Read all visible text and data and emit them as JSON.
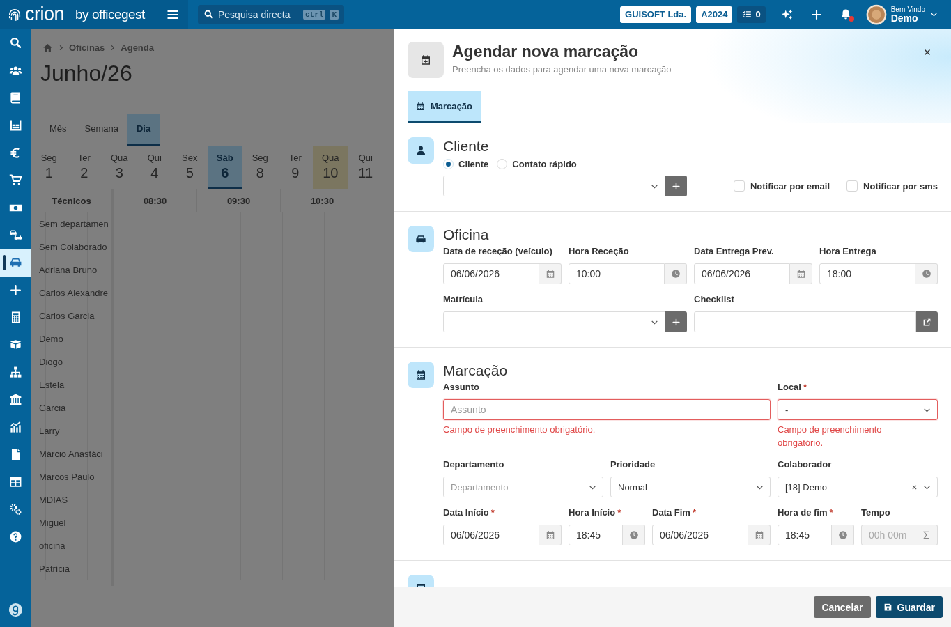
{
  "topbar": {
    "logo": "crion",
    "logo_suffix": "by officegest",
    "search": {
      "placeholder": "Pesquisa directa",
      "keys": [
        "ctrl",
        "K"
      ]
    },
    "company": "GUISOFT Lda.",
    "year": "A2024",
    "tasks": "0",
    "notifications": {
      "unread": true
    },
    "user": {
      "greeting": "Bem-Vindo",
      "name": "Demo"
    }
  },
  "sidebar": {
    "items": [
      {
        "kind": "search",
        "selected": false
      },
      {
        "kind": "users",
        "selected": false
      },
      {
        "kind": "book",
        "selected": false
      },
      {
        "kind": "shelves",
        "selected": false
      },
      {
        "kind": "euro",
        "selected": false
      },
      {
        "kind": "cart",
        "selected": false
      },
      {
        "kind": "money",
        "selected": false
      },
      {
        "kind": "cars",
        "selected": false
      },
      {
        "kind": "car",
        "selected": true
      },
      {
        "kind": "plus",
        "selected": false
      },
      {
        "kind": "calculator",
        "selected": false
      },
      {
        "kind": "box",
        "selected": false
      },
      {
        "kind": "sitemap",
        "selected": false
      },
      {
        "kind": "bank",
        "selected": false
      },
      {
        "kind": "chart",
        "selected": false
      },
      {
        "kind": "file",
        "selected": false
      },
      {
        "kind": "table",
        "selected": false
      },
      {
        "kind": "gears",
        "selected": false
      },
      {
        "kind": "help",
        "selected": false
      }
    ]
  },
  "breadcrumb": [
    "Oficinas",
    "Agenda"
  ],
  "page_title": "Junho/26",
  "view_tabs": [
    {
      "label": "Mês",
      "selected": false
    },
    {
      "label": "Semana",
      "selected": false
    },
    {
      "label": "Dia",
      "selected": true
    }
  ],
  "days": [
    {
      "weekday": "Seg",
      "day": "1",
      "selected": false,
      "today": false
    },
    {
      "weekday": "Ter",
      "day": "2",
      "selected": false,
      "today": false
    },
    {
      "weekday": "Qua",
      "day": "3",
      "selected": false,
      "today": false
    },
    {
      "weekday": "Qui",
      "day": "4",
      "selected": false,
      "today": false
    },
    {
      "weekday": "Sex",
      "day": "5",
      "selected": false,
      "today": false
    },
    {
      "weekday": "Sáb",
      "day": "6",
      "selected": true,
      "today": false
    },
    {
      "weekday": "Seg",
      "day": "8",
      "selected": false,
      "today": false
    },
    {
      "weekday": "Ter",
      "day": "9",
      "selected": false,
      "today": false
    },
    {
      "weekday": "Qua",
      "day": "10",
      "selected": false,
      "today": true
    },
    {
      "weekday": "Qui",
      "day": "11",
      "selected": false,
      "today": false
    }
  ],
  "timeline": {
    "header": "Técnicos",
    "hours": [
      "08:30",
      "09:30",
      "10:30"
    ],
    "rows": [
      "Sem departamen",
      "Sem Colaborado",
      "Adriana Bruno",
      "Carlos Alexandre",
      "Carlos Garcia",
      "Demo",
      "Diogo",
      "Estela",
      "Garcia",
      "Larry",
      "Márcio Anastáci",
      "Marcos Paulo",
      "MDIAS",
      "Miguel",
      "oficina",
      "Patrícia"
    ]
  },
  "drawer": {
    "title": "Agendar nova marcação",
    "subtitle": "Preencha os dados para agendar uma nova marcação",
    "tabs": [
      {
        "label": "Marcação",
        "selected": true
      }
    ],
    "sections": [
      {
        "kind": "client",
        "title": "Cliente",
        "client_type": [
          {
            "label": "Cliente",
            "selected": true
          },
          {
            "label": "Contato rápido",
            "selected": false
          }
        ],
        "notify": [
          {
            "label": "Notificar por email",
            "checked": false
          },
          {
            "label": "Notificar por sms",
            "checked": false
          }
        ]
      },
      {
        "kind": "workshop",
        "title": "Oficina",
        "fields": [
          {
            "label": "Data de receção (veículo)",
            "kind": "date",
            "value": "06/06/2026"
          },
          {
            "label": "Hora Receção",
            "kind": "time",
            "value": "10:00"
          },
          {
            "label": "Data Entrega Prev.",
            "kind": "date",
            "value": "06/06/2026"
          },
          {
            "label": "Hora Entrega",
            "kind": "time",
            "value": "18:00"
          },
          {
            "label": "Matrícula",
            "kind": "select_add"
          },
          {
            "label": "Checklist",
            "kind": "link_input"
          }
        ]
      },
      {
        "kind": "appointment",
        "title": "Marcação",
        "fields": [
          {
            "label": "Assunto",
            "kind": "text",
            "placeholder": "Assunto",
            "error": "Campo de preenchimento obrigatório."
          },
          {
            "label": "Local",
            "required_mark": "*",
            "kind": "select",
            "value": "-",
            "error": "Campo de preenchimento obrigatório."
          },
          {
            "label": "Departamento",
            "kind": "select",
            "placeholder": "Departamento"
          },
          {
            "label": "Prioridade",
            "kind": "select",
            "value": "Normal"
          },
          {
            "label": "Colaborador",
            "kind": "select",
            "value": "[18] Demo",
            "clearable": true
          },
          {
            "label": "Data Início",
            "required_mark": "*",
            "kind": "date",
            "value": "06/06/2026"
          },
          {
            "label": "Hora Início",
            "required_mark": "*",
            "kind": "time",
            "value": "18:45"
          },
          {
            "label": "Data Fim",
            "required_mark": "*",
            "kind": "date",
            "value": "06/06/2026"
          },
          {
            "label": "Hora de fim",
            "required_mark": "*",
            "kind": "time",
            "value": "18:45"
          },
          {
            "label": "Tempo",
            "kind": "duration",
            "value": "00h 00m",
            "disabled": true
          }
        ]
      },
      {
        "kind": "notes"
      }
    ],
    "buttons": [
      {
        "kind": "cancel",
        "label": "Cancelar"
      },
      {
        "kind": "save",
        "label": "Guardar"
      }
    ]
  }
}
